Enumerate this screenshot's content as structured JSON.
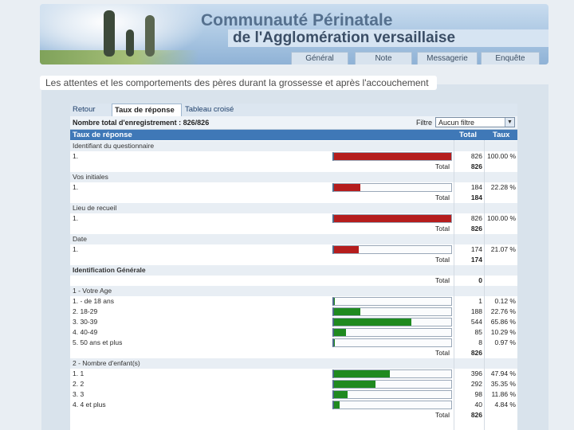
{
  "header": {
    "title_line1": "Communauté Périnatale",
    "title_line2": "de l'Agglomération versaillaise",
    "nav": [
      "Général",
      "Note",
      "Messagerie",
      "Enquête"
    ]
  },
  "page_subtitle": "Les attentes et les comportements des pères durant la grossesse et après l'accouchement",
  "tabs": [
    {
      "label": "Retour",
      "active": false
    },
    {
      "label": "Taux de réponse",
      "active": true
    },
    {
      "label": "Tableau croisé",
      "active": false
    }
  ],
  "info": {
    "total_label": "Nombre total d'enregistrement : 826/826",
    "filtre_label": "Filtre",
    "filtre_value": "Aucun filtre"
  },
  "table_header": {
    "col1": "Taux de réponse",
    "col2": "Total",
    "col3": "Taux"
  },
  "colors": {
    "red_bar": "#b51d1d",
    "green_bar": "#1f8a1f",
    "header_blue": "#3f78b7"
  },
  "rows": [
    {
      "kind": "section",
      "label": "Identifiant du questionnaire"
    },
    {
      "kind": "item",
      "label": "1.",
      "count": "826",
      "pct": "100.00 %",
      "fraction": 1.0,
      "color": "red"
    },
    {
      "kind": "total",
      "label": "Total",
      "value": "826"
    },
    {
      "kind": "section",
      "label": "Vos initiales"
    },
    {
      "kind": "item",
      "label": "1.",
      "count": "184",
      "pct": "22.28 %",
      "fraction": 0.2228,
      "color": "red"
    },
    {
      "kind": "total",
      "label": "Total",
      "value": "184"
    },
    {
      "kind": "section",
      "label": "Lieu de recueil"
    },
    {
      "kind": "item",
      "label": "1.",
      "count": "826",
      "pct": "100.00 %",
      "fraction": 1.0,
      "color": "red"
    },
    {
      "kind": "total",
      "label": "Total",
      "value": "826"
    },
    {
      "kind": "section",
      "label": "Date"
    },
    {
      "kind": "item",
      "label": "1.",
      "count": "174",
      "pct": "21.07 %",
      "fraction": 0.2107,
      "color": "red"
    },
    {
      "kind": "total",
      "label": "Total",
      "value": "174"
    },
    {
      "kind": "section",
      "label": "Identification Générale",
      "bold": true
    },
    {
      "kind": "total",
      "label": "Total",
      "value": "0"
    },
    {
      "kind": "section",
      "label": "1 - Votre Age"
    },
    {
      "kind": "item",
      "label": "1. - de 18 ans",
      "count": "1",
      "pct": "0.12 %",
      "fraction": 0.0012,
      "color": "green"
    },
    {
      "kind": "item",
      "label": "2. 18-29",
      "count": "188",
      "pct": "22.76 %",
      "fraction": 0.2276,
      "color": "green"
    },
    {
      "kind": "item",
      "label": "3. 30-39",
      "count": "544",
      "pct": "65.86 %",
      "fraction": 0.6586,
      "color": "green"
    },
    {
      "kind": "item",
      "label": "4. 40-49",
      "count": "85",
      "pct": "10.29 %",
      "fraction": 0.1029,
      "color": "green"
    },
    {
      "kind": "item",
      "label": "5. 50 ans et plus",
      "count": "8",
      "pct": "0.97 %",
      "fraction": 0.0097,
      "color": "green"
    },
    {
      "kind": "total",
      "label": "Total",
      "value": "826"
    },
    {
      "kind": "section",
      "label": "2 - Nombre d'enfant(s)"
    },
    {
      "kind": "item",
      "label": "1. 1",
      "count": "396",
      "pct": "47.94 %",
      "fraction": 0.4794,
      "color": "green"
    },
    {
      "kind": "item",
      "label": "2. 2",
      "count": "292",
      "pct": "35.35 %",
      "fraction": 0.3535,
      "color": "green"
    },
    {
      "kind": "item",
      "label": "3. 3",
      "count": "98",
      "pct": "11.86 %",
      "fraction": 0.1186,
      "color": "green"
    },
    {
      "kind": "item",
      "label": "4. 4 et plus",
      "count": "40",
      "pct": "4.84 %",
      "fraction": 0.0484,
      "color": "green"
    },
    {
      "kind": "total",
      "label": "Total",
      "value": "826"
    }
  ]
}
